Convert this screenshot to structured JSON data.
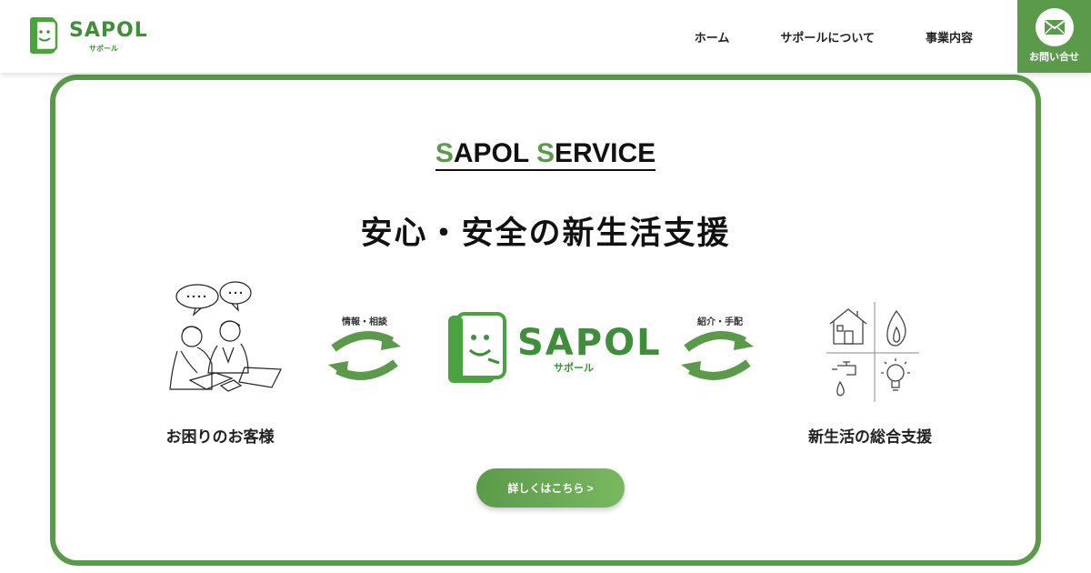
{
  "header": {
    "logo_text": "SAPOL",
    "logo_sub": "サポール",
    "nav": [
      "ホーム",
      "サポールについて",
      "事業内容"
    ],
    "contact_label": "お問い合せ"
  },
  "service": {
    "title_s1": "S",
    "title_rest1": "APOL ",
    "title_s2": "S",
    "title_rest2": "ERVICE",
    "headline": "安心・安全の新生活支援",
    "left_label": "お困りのお客様",
    "right_label": "新生活の総合支援",
    "left_arrow_label": "情報・相談",
    "right_arrow_label": "紹介・手配",
    "center_logo_text": "SAPOL",
    "center_logo_sub": "サポール",
    "detail_button": "詳しくはこちら >"
  },
  "colors": {
    "accent": "#5a9a4a",
    "logo_green": "#3f8f3a"
  },
  "icons": [
    "mail-icon",
    "people-consulting-illustration",
    "house-icon",
    "flame-icon",
    "faucet-icon",
    "lightbulb-icon",
    "cycle-arrows-icon"
  ]
}
